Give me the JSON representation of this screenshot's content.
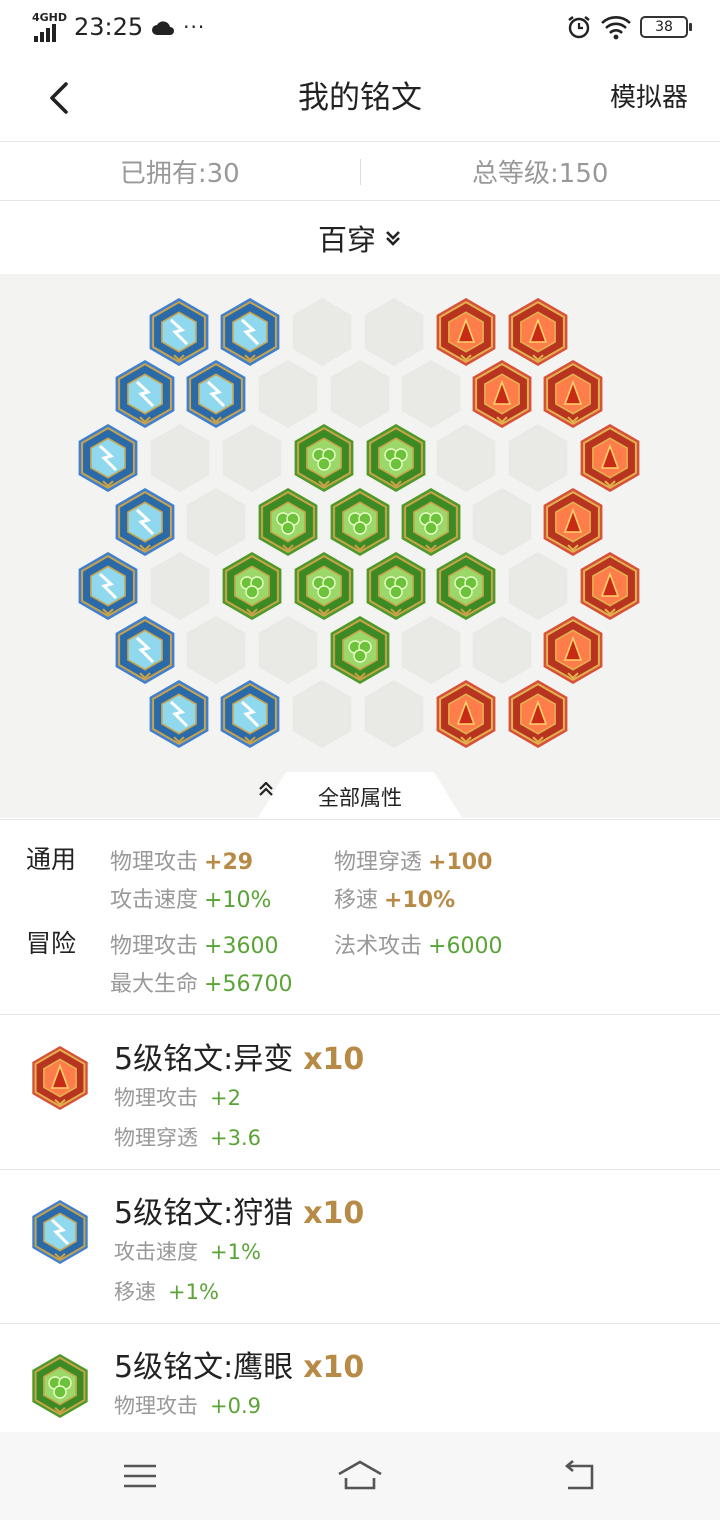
{
  "status_bar": {
    "network": "4GHD",
    "time": "23:25",
    "extra": "···",
    "battery": "38"
  },
  "nav": {
    "title": "我的铭文",
    "simulator": "模拟器"
  },
  "summary": {
    "owned": "已拥有:30",
    "total_level": "总等级:150"
  },
  "selector": {
    "page_name": "百穿"
  },
  "board": {
    "tab_label": "全部属性",
    "slots": [
      {
        "color": "blue"
      },
      {
        "color": "blue"
      },
      {
        "color": "empty"
      },
      {
        "color": "empty"
      },
      {
        "color": "red"
      },
      {
        "color": "red"
      },
      {
        "color": "blue"
      },
      {
        "color": "blue"
      },
      {
        "color": "empty"
      },
      {
        "color": "empty"
      },
      {
        "color": "empty"
      },
      {
        "color": "red"
      },
      {
        "color": "red"
      },
      {
        "color": "blue"
      },
      {
        "color": "empty"
      },
      {
        "color": "empty"
      },
      {
        "color": "green"
      },
      {
        "color": "green"
      },
      {
        "color": "empty"
      },
      {
        "color": "empty"
      },
      {
        "color": "red"
      },
      {
        "color": "blue"
      },
      {
        "color": "empty"
      },
      {
        "color": "green"
      },
      {
        "color": "green"
      },
      {
        "color": "green"
      },
      {
        "color": "empty"
      },
      {
        "color": "red"
      },
      {
        "color": "blue"
      },
      {
        "color": "empty"
      },
      {
        "color": "green"
      },
      {
        "color": "green"
      },
      {
        "color": "green"
      },
      {
        "color": "green"
      },
      {
        "color": "empty"
      },
      {
        "color": "red"
      },
      {
        "color": "blue"
      },
      {
        "color": "empty"
      },
      {
        "color": "empty"
      },
      {
        "color": "green"
      },
      {
        "color": "empty"
      },
      {
        "color": "empty"
      },
      {
        "color": "red"
      },
      {
        "color": "blue"
      },
      {
        "color": "blue"
      },
      {
        "color": "empty"
      },
      {
        "color": "empty"
      },
      {
        "color": "red"
      },
      {
        "color": "red"
      }
    ]
  },
  "attributes": {
    "general_label": "通用",
    "general": [
      {
        "name": "物理攻击",
        "value": "+29",
        "style": "gold"
      },
      {
        "name": "物理穿透",
        "value": "+100",
        "style": "gold"
      },
      {
        "name": "攻击速度",
        "value": "+10%",
        "style": "green"
      },
      {
        "name": "移速",
        "value": "+10%",
        "style": "gold"
      }
    ],
    "adventure_label": "冒险",
    "adventure": [
      {
        "name": "物理攻击",
        "value": "+3600",
        "style": "green"
      },
      {
        "name": "法术攻击",
        "value": "+6000",
        "style": "green"
      },
      {
        "name": "最大生命",
        "value": "+56700",
        "style": "green"
      }
    ]
  },
  "inscriptions": [
    {
      "icon": "red-inscription-icon",
      "title": "5级铭文:异变",
      "count": "x10",
      "stats": [
        {
          "name": "物理攻击",
          "value": "+2"
        },
        {
          "name": "物理穿透",
          "value": "+3.6"
        }
      ]
    },
    {
      "icon": "blue-inscription-icon",
      "title": "5级铭文:狩猎",
      "count": "x10",
      "stats": [
        {
          "name": "攻击速度",
          "value": "+1%"
        },
        {
          "name": "移速",
          "value": "+1%"
        }
      ]
    },
    {
      "icon": "green-inscription-icon",
      "title": "5级铭文:鹰眼",
      "count": "x10",
      "stats": [
        {
          "name": "物理攻击",
          "value": "+0.9"
        }
      ]
    }
  ],
  "bottom_nav": {
    "items": [
      "menu-icon",
      "home-icon",
      "back-icon"
    ]
  },
  "colors": {
    "gold": "#b78a46",
    "green_text": "#5aa336",
    "gem_blue": "#3f7fd0",
    "gem_red": "#d9503a",
    "gem_green": "#4c9a2a"
  }
}
